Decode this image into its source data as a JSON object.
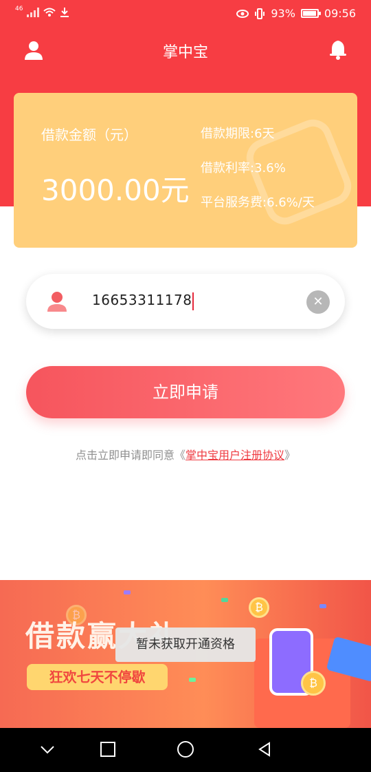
{
  "status_bar": {
    "signal_label": "46",
    "battery_percent": "93%",
    "time": "09:56",
    "icons": [
      "signal-icon",
      "wifi-icon",
      "download-icon",
      "eye-icon",
      "vibrate-icon",
      "battery-icon"
    ]
  },
  "app_bar": {
    "title": "掌中宝",
    "left_icon": "user-icon",
    "right_icon": "bell-icon"
  },
  "loan_card": {
    "amount_label": "借款金额（元）",
    "amount": "3000.00元",
    "term": "借款期限:6天",
    "rate": "借款利率:3.6%",
    "service_fee": "平台服务费:6.6%/天"
  },
  "phone_input": {
    "value": "16653311178",
    "clear_icon": "clear-icon"
  },
  "apply_button": {
    "label": "立即申请"
  },
  "agreement": {
    "prefix": "点击立即申请即同意《",
    "link_text": "掌中宝用户注册协议",
    "suffix": "》"
  },
  "banner": {
    "title": "借款赢大礼",
    "subtitle": "狂欢七天不停歇"
  },
  "toast": {
    "message": "暂未获取开通资格"
  },
  "nav_bar": {
    "icons": [
      "back-icon",
      "home-icon",
      "recents-icon",
      "triangle-back-icon"
    ]
  },
  "colors": {
    "primary_red": "#f73d43",
    "card_yellow": "#ffcf7b",
    "button_gradient_start": "#f6555d",
    "button_gradient_end": "#ff787c",
    "link_red": "#ef3a40"
  }
}
